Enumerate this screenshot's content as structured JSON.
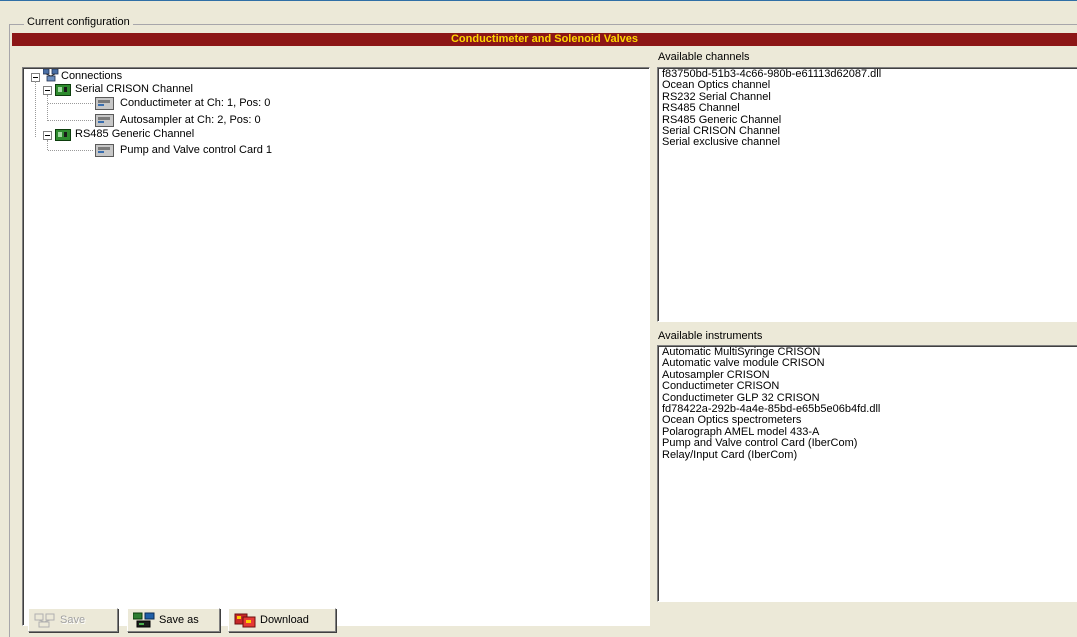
{
  "group": {
    "caption": "Current configuration"
  },
  "title": "Conductimeter and Solenoid Valves",
  "tree": {
    "root": "Connections",
    "channels": [
      {
        "label": "Serial CRISON Channel",
        "devices": [
          "Conductimeter at Ch: 1, Pos: 0",
          "Autosampler at Ch: 2, Pos: 0"
        ]
      },
      {
        "label": "RS485 Generic Channel",
        "devices": [
          "Pump and Valve control Card 1"
        ]
      }
    ]
  },
  "available_channels": {
    "label": "Available channels",
    "items": [
      "f83750bd-51b3-4c66-980b-e61113d62087.dll",
      "Ocean Optics channel",
      "RS232 Serial Channel",
      "RS485 Channel",
      "RS485 Generic Channel",
      "Serial CRISON Channel",
      "Serial exclusive channel"
    ]
  },
  "available_instruments": {
    "label": "Available instruments",
    "items": [
      "Automatic MultiSyringe CRISON",
      "Automatic valve module CRISON",
      "Autosampler CRISON",
      "Conductimeter CRISON",
      "Conductimeter GLP 32 CRISON",
      "fd78422a-292b-4a4e-85bd-e65b5e06b4fd.dll",
      "Ocean Optics spectrometers",
      "Polarograph AMEL model 433-A",
      "Pump and Valve control Card (IberCom)",
      "Relay/Input Card (IberCom)"
    ]
  },
  "toolbar": {
    "save_label": "Save",
    "save_as_label": "Save as",
    "download_label": "Download"
  },
  "colors": {
    "title_bg": "#8c1616",
    "title_fg": "#ffd800",
    "window_bg": "#ece9d8"
  }
}
